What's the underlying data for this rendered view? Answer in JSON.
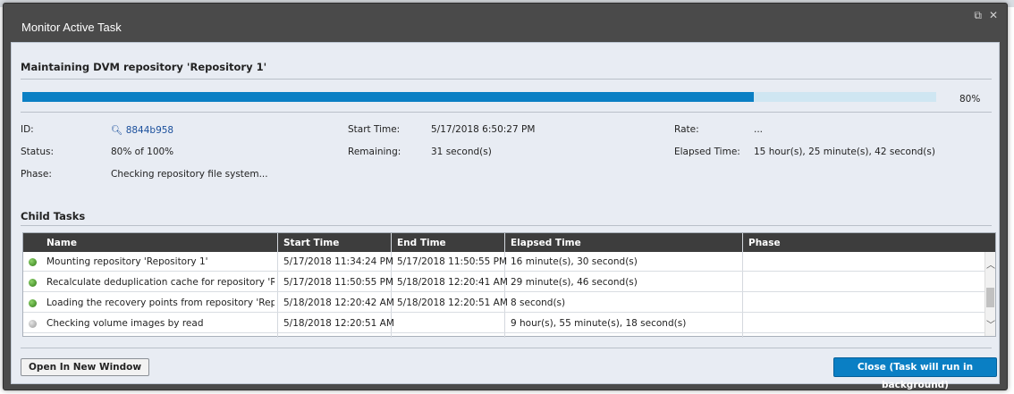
{
  "window": {
    "title": "Monitor Active Task",
    "popout_glyph": "⧉",
    "close_glyph": "✕"
  },
  "task": {
    "title": "Maintaining DVM repository 'Repository 1'",
    "progress_percent": 80,
    "progress_label": "80%",
    "fields": {
      "id_label": "ID:",
      "id_value": "8844b958",
      "status_label": "Status:",
      "status_value": "80% of 100%",
      "phase_label": "Phase:",
      "phase_value": "Checking repository file system...",
      "start_label": "Start Time:",
      "start_value": "5/17/2018 6:50:27 PM",
      "remaining_label": "Remaining:",
      "remaining_value": "31 second(s)",
      "rate_label": "Rate:",
      "rate_value": "...",
      "elapsed_label": "Elapsed Time:",
      "elapsed_value": "15 hour(s), 25 minute(s), 42 second(s)"
    }
  },
  "child_tasks": {
    "title": "Child Tasks",
    "columns": [
      "Name",
      "Start Time",
      "End Time",
      "Elapsed Time",
      "Phase"
    ],
    "rows": [
      {
        "status": "done",
        "name": "Mounting repository 'Repository 1'",
        "start": "5/17/2018 11:34:24 PM",
        "end": "5/17/2018 11:50:55 PM",
        "elapsed": "16 minute(s), 30 second(s)",
        "phase": ""
      },
      {
        "status": "done",
        "name": "Recalculate deduplication cache for repository 'Reposit...",
        "start": "5/17/2018 11:50:55 PM",
        "end": "5/18/2018 12:20:41 AM",
        "elapsed": "29 minute(s), 46 second(s)",
        "phase": ""
      },
      {
        "status": "done",
        "name": "Loading the recovery points from repository 'Repository...",
        "start": "5/18/2018 12:20:42 AM",
        "end": "5/18/2018 12:20:51 AM",
        "elapsed": "8 second(s)",
        "phase": ""
      },
      {
        "status": "pending",
        "name": "Checking volume images by read",
        "start": "5/18/2018 12:20:51 AM",
        "end": "",
        "elapsed": "9 hour(s), 55 minute(s), 18 second(s)",
        "phase": ""
      }
    ]
  },
  "buttons": {
    "open_new_window": "Open In New Window",
    "close_background": "Close (Task will run in background)"
  },
  "colors": {
    "accent": "#0a7fc4",
    "header_bg": "#3d3d3d",
    "dialog_bg": "#4a4a4a"
  }
}
